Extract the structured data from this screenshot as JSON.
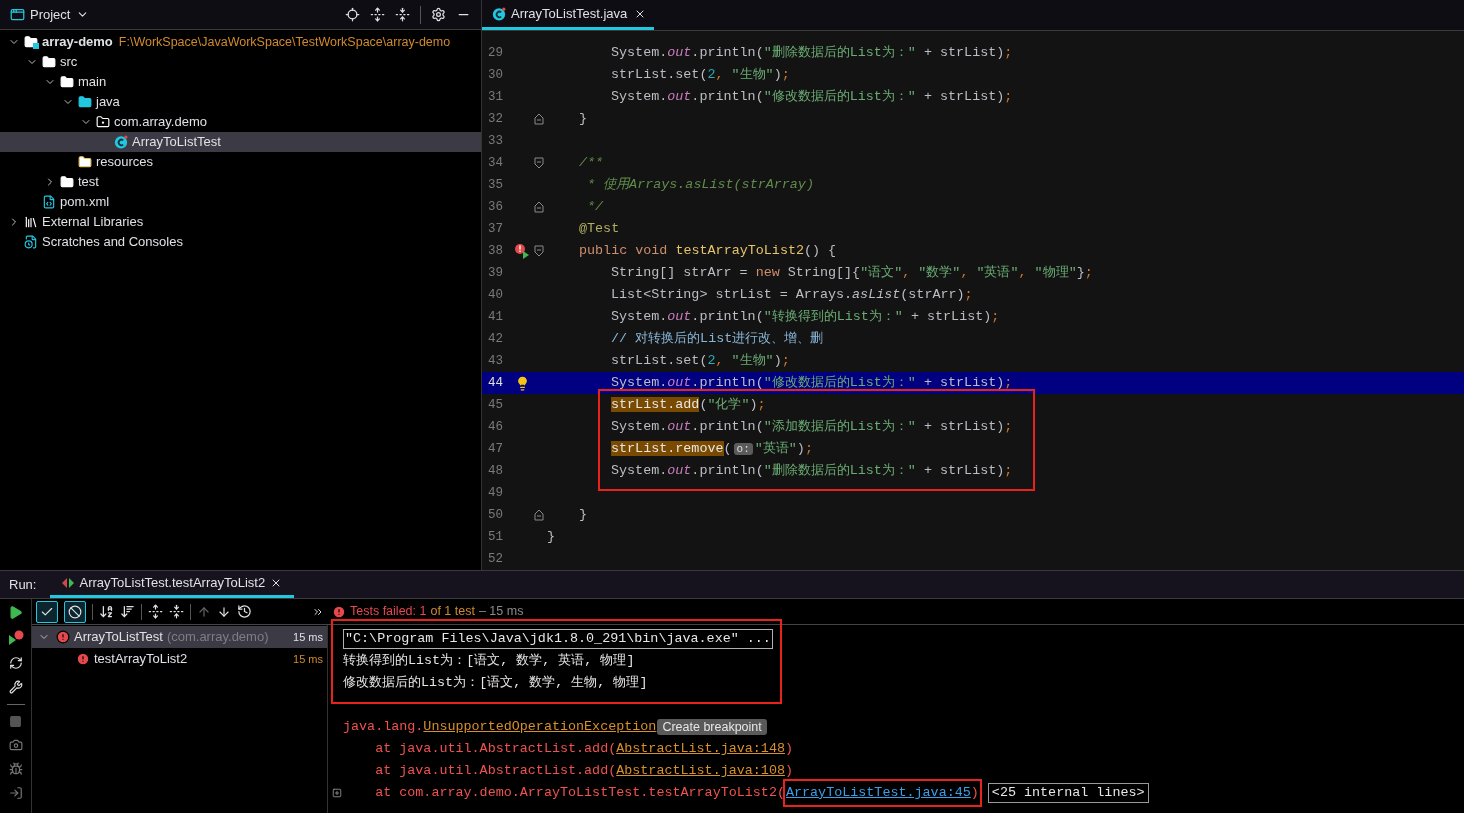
{
  "project": {
    "title": "Project",
    "tree": [
      {
        "label": "array-demo",
        "path": "F:\\WorkSpace\\JavaWorkSpace\\TestWorkSpace\\array-demo",
        "kind": "module",
        "expanded": true,
        "selected": false,
        "children": [
          {
            "label": "src",
            "kind": "folder",
            "expanded": true,
            "selected": false,
            "children": [
              {
                "label": "main",
                "kind": "folder",
                "expanded": true,
                "selected": false,
                "children": [
                  {
                    "label": "java",
                    "kind": "source-folder",
                    "expanded": true,
                    "selected": false,
                    "children": [
                      {
                        "label": "com.array.demo",
                        "kind": "package",
                        "expanded": true,
                        "selected": false,
                        "children": [
                          {
                            "label": "ArrayToListTest",
                            "kind": "class",
                            "selected": true
                          }
                        ]
                      }
                    ]
                  },
                  {
                    "label": "resources",
                    "kind": "resources",
                    "selected": false
                  }
                ]
              },
              {
                "label": "test",
                "kind": "folder",
                "expanded": false,
                "selected": false
              }
            ]
          },
          {
            "label": "pom.xml",
            "kind": "maven",
            "selected": false
          }
        ]
      },
      {
        "label": "External Libraries",
        "kind": "libraries",
        "expanded": false,
        "selected": false
      },
      {
        "label": "Scratches and Consoles",
        "kind": "scratches",
        "selected": false
      }
    ]
  },
  "editor": {
    "tabs": [
      {
        "label": "ArrayToListTest.java",
        "selected": true
      }
    ],
    "lines": [
      {
        "number": "29",
        "indent": {
          "kind": "body"
        },
        "tokens": [
          {
            "text": "System.",
            "kind": "plain"
          },
          {
            "text": "out",
            "kind": "field"
          },
          {
            "text": ".println(",
            "kind": "plain"
          },
          {
            "text": "\"删除数据后的List为：\"",
            "kind": "string"
          },
          {
            "text": " + strList)",
            "kind": "plain"
          },
          {
            "text": ";",
            "kind": "punct"
          }
        ]
      },
      {
        "number": "30",
        "indent": {
          "kind": "body"
        },
        "tokens": [
          {
            "text": "strList.set(",
            "kind": "plain"
          },
          {
            "text": "2",
            "kind": "number"
          },
          {
            "text": ", ",
            "kind": "punct"
          },
          {
            "text": "\"生物\"",
            "kind": "string"
          },
          {
            "text": ")",
            "kind": "plain"
          },
          {
            "text": ";",
            "kind": "punct"
          }
        ]
      },
      {
        "number": "31",
        "indent": {
          "kind": "body"
        },
        "tokens": [
          {
            "text": "System.",
            "kind": "plain"
          },
          {
            "text": "out",
            "kind": "field"
          },
          {
            "text": ".println(",
            "kind": "plain"
          },
          {
            "text": "\"修改数据后的List为：\"",
            "kind": "string"
          },
          {
            "text": " + strList)",
            "kind": "plain"
          },
          {
            "text": ";",
            "kind": "punct"
          }
        ]
      },
      {
        "number": "32",
        "fold": {
          "kind": "end"
        },
        "indent": {
          "kind": "member"
        },
        "tokens": [
          {
            "text": "}",
            "kind": "plain"
          }
        ]
      },
      {
        "number": "33"
      },
      {
        "number": "34",
        "fold": {
          "kind": "start"
        },
        "indent": {
          "kind": "member"
        },
        "tokens": [
          {
            "text": "/**",
            "kind": "doc"
          }
        ]
      },
      {
        "number": "35",
        "indent": {
          "kind": "member"
        },
        "tokens": [
          {
            "text": " * 使用Arrays.asList(strArray)",
            "kind": "doc"
          }
        ]
      },
      {
        "number": "36",
        "fold": {
          "kind": "end"
        },
        "indent": {
          "kind": "member"
        },
        "tokens": [
          {
            "text": " */",
            "kind": "doc"
          }
        ]
      },
      {
        "number": "37",
        "indent": {
          "kind": "member"
        },
        "tokens": [
          {
            "text": "@Test",
            "kind": "annotation"
          }
        ]
      },
      {
        "number": "38",
        "fold": {
          "kind": "start"
        },
        "marker": {
          "kind": "run-failed"
        },
        "indent": {
          "kind": "member"
        },
        "tokens": [
          {
            "text": "public void ",
            "kind": "keyword"
          },
          {
            "text": "testArrayToList2",
            "kind": "method"
          },
          {
            "text": "() {",
            "kind": "plain"
          }
        ]
      },
      {
        "number": "39",
        "indent": {
          "kind": "body"
        },
        "tokens": [
          {
            "text": "String[] strArr = ",
            "kind": "plain"
          },
          {
            "text": "new ",
            "kind": "keyword"
          },
          {
            "text": "String[]{",
            "kind": "plain"
          },
          {
            "text": "\"语文\"",
            "kind": "string"
          },
          {
            "text": ", ",
            "kind": "punct"
          },
          {
            "text": "\"数学\"",
            "kind": "string"
          },
          {
            "text": ", ",
            "kind": "punct"
          },
          {
            "text": "\"英语\"",
            "kind": "string"
          },
          {
            "text": ", ",
            "kind": "punct"
          },
          {
            "text": "\"物理\"",
            "kind": "string"
          },
          {
            "text": "}",
            "kind": "plain"
          },
          {
            "text": ";",
            "kind": "punct"
          }
        ]
      },
      {
        "number": "40",
        "indent": {
          "kind": "body"
        },
        "tokens": [
          {
            "text": "List<String> strList = Arrays.",
            "kind": "plain"
          },
          {
            "text": "asList",
            "kind": "static"
          },
          {
            "text": "(strArr)",
            "kind": "plain"
          },
          {
            "text": ";",
            "kind": "punct"
          }
        ]
      },
      {
        "number": "41",
        "indent": {
          "kind": "body"
        },
        "tokens": [
          {
            "text": "System.",
            "kind": "plain"
          },
          {
            "text": "out",
            "kind": "field"
          },
          {
            "text": ".println(",
            "kind": "plain"
          },
          {
            "text": "\"转换得到的List为：\"",
            "kind": "string"
          },
          {
            "text": " + strList)",
            "kind": "plain"
          },
          {
            "text": ";",
            "kind": "punct"
          }
        ]
      },
      {
        "number": "42",
        "indent": {
          "kind": "body"
        },
        "tokens": [
          {
            "text": "// 对转换后的List进行改、增、删",
            "kind": "comment"
          }
        ]
      },
      {
        "number": "43",
        "indent": {
          "kind": "body"
        },
        "tokens": [
          {
            "text": "strList.set(",
            "kind": "plain"
          },
          {
            "text": "2",
            "kind": "number"
          },
          {
            "text": ", ",
            "kind": "punct"
          },
          {
            "text": "\"生物\"",
            "kind": "string"
          },
          {
            "text": ")",
            "kind": "plain"
          },
          {
            "text": ";",
            "kind": "punct"
          }
        ]
      },
      {
        "number": "44",
        "current": true,
        "marker": {
          "kind": "intention"
        },
        "indent": {
          "kind": "body"
        },
        "tokens": [
          {
            "text": "System.",
            "kind": "plain"
          },
          {
            "text": "out",
            "kind": "field"
          },
          {
            "text": ".println(",
            "kind": "plain"
          },
          {
            "text": "\"修改数据后的List为：\"",
            "kind": "string"
          },
          {
            "text": " + strList)",
            "kind": "plain"
          },
          {
            "text": ";",
            "kind": "punct"
          }
        ]
      },
      {
        "number": "45",
        "indent": {
          "kind": "body"
        },
        "tokens": [
          {
            "text": "strList.add",
            "kind": "highlight"
          },
          {
            "text": "(",
            "kind": "plain"
          },
          {
            "text": "\"化学\"",
            "kind": "string"
          },
          {
            "text": ")",
            "kind": "plain"
          },
          {
            "text": ";",
            "kind": "punct"
          }
        ]
      },
      {
        "number": "46",
        "indent": {
          "kind": "body"
        },
        "tokens": [
          {
            "text": "System.",
            "kind": "plain"
          },
          {
            "text": "out",
            "kind": "field"
          },
          {
            "text": ".println(",
            "kind": "plain"
          },
          {
            "text": "\"添加数据后的List为：\"",
            "kind": "string"
          },
          {
            "text": " + strList)",
            "kind": "plain"
          },
          {
            "text": ";",
            "kind": "punct"
          }
        ]
      },
      {
        "number": "47",
        "indent": {
          "kind": "body"
        },
        "tokens": [
          {
            "text": "strList.remove",
            "kind": "highlight"
          },
          {
            "text": "(",
            "kind": "plain"
          },
          {
            "text": "o:",
            "kind": "hint"
          },
          {
            "text": "\"英语\"",
            "kind": "string"
          },
          {
            "text": ")",
            "kind": "plain"
          },
          {
            "text": ";",
            "kind": "punct"
          }
        ]
      },
      {
        "number": "48",
        "indent": {
          "kind": "body"
        },
        "tokens": [
          {
            "text": "System.",
            "kind": "plain"
          },
          {
            "text": "out",
            "kind": "field"
          },
          {
            "text": ".println(",
            "kind": "plain"
          },
          {
            "text": "\"删除数据后的List为：\"",
            "kind": "string"
          },
          {
            "text": " + strList)",
            "kind": "plain"
          },
          {
            "text": ";",
            "kind": "punct"
          }
        ]
      },
      {
        "number": "49"
      },
      {
        "number": "50",
        "fold": {
          "kind": "end"
        },
        "indent": {
          "kind": "member"
        },
        "tokens": [
          {
            "text": "}",
            "kind": "plain"
          }
        ]
      },
      {
        "number": "51",
        "indent": {
          "kind": "top"
        },
        "tokens": [
          {
            "text": "}",
            "kind": "plain"
          }
        ]
      },
      {
        "number": "52"
      }
    ]
  },
  "run": {
    "label": "Run:",
    "tabs": [
      {
        "label": "ArrayToListTest.testArrayToList2",
        "selected": true
      }
    ],
    "toggles": [
      {
        "selected": true
      },
      {
        "selected": true
      }
    ],
    "status": {
      "failed": "Tests failed: 1",
      "total": "of 1 test",
      "duration": "– 15 ms"
    },
    "tests": [
      {
        "name": "ArrayToListTest",
        "package": "(com.array.demo)",
        "time": "15 ms",
        "selected": true,
        "children": [
          {
            "name": "testArrayToList2",
            "time": "15 ms",
            "selected": false
          }
        ]
      }
    ],
    "output": [
      {
        "kind": "command",
        "text": "\"C:\\Program Files\\Java\\jdk1.8.0_291\\bin\\java.exe\" ..."
      },
      {
        "kind": "stdout",
        "text": "转换得到的List为：[语文, 数学, 英语, 物理]"
      },
      {
        "kind": "stdout",
        "text": "修改数据后的List为：[语文, 数学, 生物, 物理]"
      },
      {
        "kind": "blank"
      },
      {
        "kind": "exception",
        "prefix": "java.lang.",
        "link": "UnsupportedOperationException",
        "badge": "Create breakpoint"
      },
      {
        "kind": "frame",
        "prefix": "    at java.util.AbstractList.add(",
        "link": "AbstractList.java:148",
        "suffix": ")",
        "in_project": false,
        "boxed": false
      },
      {
        "kind": "frame",
        "prefix": "    at java.util.AbstractList.add(",
        "link": "AbstractList.java:108",
        "suffix": ")",
        "in_project": false,
        "boxed": false
      },
      {
        "kind": "frame",
        "prefix": "    at com.array.demo.ArrayToListTest.testArrayToList2(",
        "link": "ArrayToListTest.java:45",
        "suffix": ")",
        "in_project": true,
        "boxed": true,
        "folded": "<25 internal lines>"
      }
    ]
  }
}
